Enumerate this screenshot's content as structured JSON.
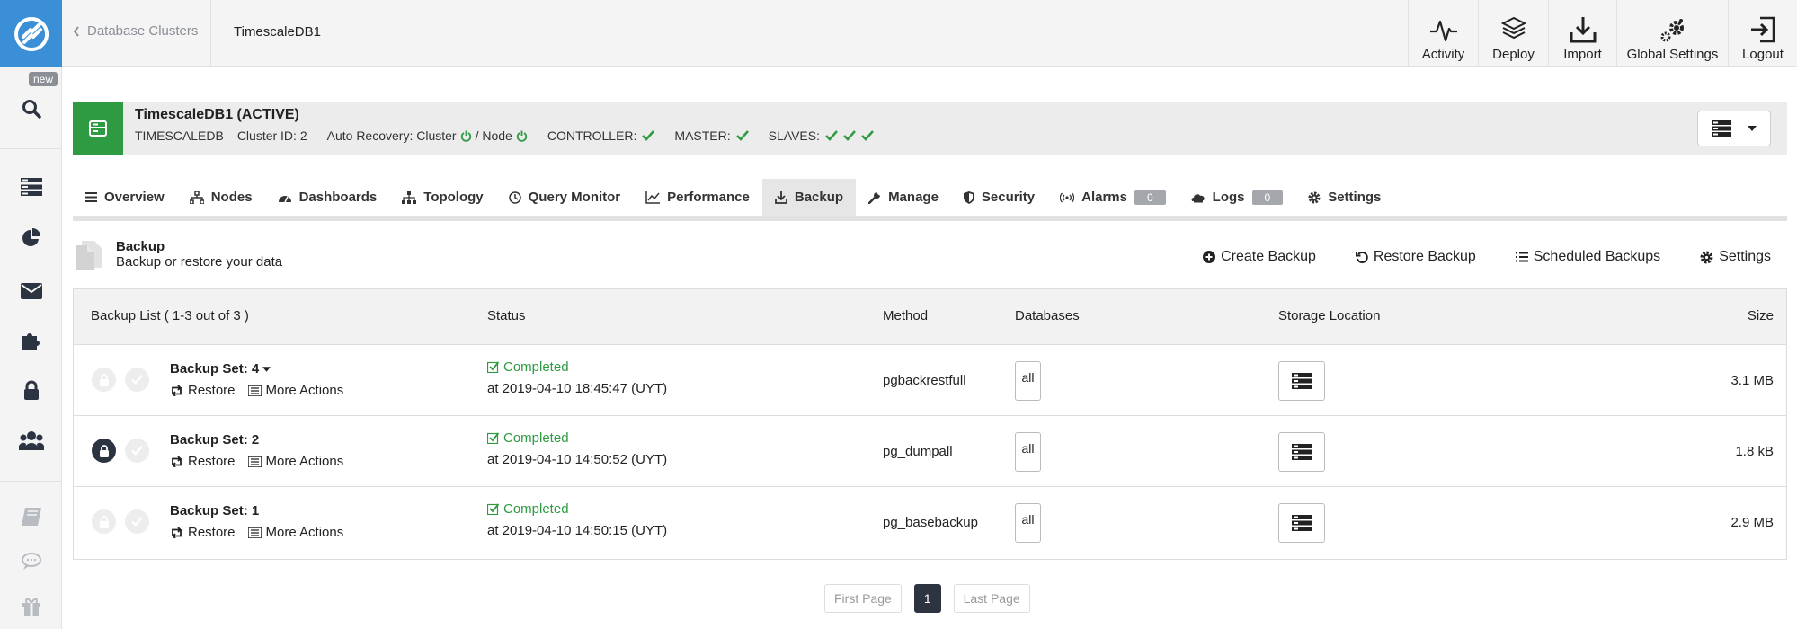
{
  "sidebar": {
    "new_badge": "new",
    "icons": [
      "search-icon",
      "clusters-icon",
      "pie-chart-icon",
      "mail-icon",
      "puzzle-icon",
      "lock-icon",
      "users-icon",
      "book-icon",
      "chat-icon",
      "gift-icon"
    ]
  },
  "topbar": {
    "back_label": "Database Clusters",
    "current": "TimescaleDB1",
    "nav": [
      {
        "label": "Activity",
        "icon": "activity-icon"
      },
      {
        "label": "Deploy",
        "icon": "deploy-icon"
      },
      {
        "label": "Import",
        "icon": "import-icon"
      },
      {
        "label": "Global Settings",
        "icon": "gears-icon"
      },
      {
        "label": "Logout",
        "icon": "logout-icon"
      }
    ]
  },
  "cluster": {
    "title": "TimescaleDB1 (ACTIVE)",
    "type": "TIMESCALEDB",
    "cluster_id": "Cluster ID: 2",
    "auto_recovery": "Auto Recovery: Cluster",
    "node_label": "/ Node",
    "controller": "CONTROLLER:",
    "master": "MASTER:",
    "slaves": "SLAVES:",
    "status_color": "#2e9a42"
  },
  "tabs": [
    {
      "label": "Overview",
      "icon": "list-icon"
    },
    {
      "label": "Nodes",
      "icon": "nodes-icon"
    },
    {
      "label": "Dashboards",
      "icon": "dashboard-icon"
    },
    {
      "label": "Topology",
      "icon": "topology-icon"
    },
    {
      "label": "Query Monitor",
      "icon": "query-icon"
    },
    {
      "label": "Performance",
      "icon": "chart-icon"
    },
    {
      "label": "Backup",
      "icon": "download-icon",
      "active": true
    },
    {
      "label": "Manage",
      "icon": "wrench-icon"
    },
    {
      "label": "Security",
      "icon": "shield-icon"
    },
    {
      "label": "Alarms",
      "icon": "alarm-icon",
      "count": "0"
    },
    {
      "label": "Logs",
      "icon": "logs-icon",
      "count": "0"
    },
    {
      "label": "Settings",
      "icon": "gear-icon"
    }
  ],
  "backup": {
    "title": "Backup",
    "subtitle": "Backup or restore your data",
    "actions": {
      "create": "Create Backup",
      "restore": "Restore Backup",
      "scheduled": "Scheduled Backups",
      "settings": "Settings"
    }
  },
  "table": {
    "headers": {
      "list": "Backup List ( 1-3 out of 3 )",
      "status": "Status",
      "method": "Method",
      "databases": "Databases",
      "storage": "Storage Location",
      "size": "Size"
    },
    "restore_label": "Restore",
    "more_actions_label": "More Actions",
    "rows": [
      {
        "name": "Backup Set: 4",
        "status": "Completed",
        "time": "at 2019-04-10 18:45:47 (UYT)",
        "method": "pgbackrestfull",
        "databases": "all",
        "size": "3.1 MB",
        "locked": false
      },
      {
        "name": "Backup Set: 2",
        "status": "Completed",
        "time": "at 2019-04-10 14:50:52 (UYT)",
        "method": "pg_dumpall",
        "databases": "all",
        "size": "1.8 kB",
        "locked": true
      },
      {
        "name": "Backup Set: 1",
        "status": "Completed",
        "time": "at 2019-04-10 14:50:15 (UYT)",
        "method": "pg_basebackup",
        "databases": "all",
        "size": "2.9 MB",
        "locked": false
      }
    ]
  },
  "pagination": {
    "first": "First Page",
    "current": "1",
    "last": "Last Page"
  }
}
